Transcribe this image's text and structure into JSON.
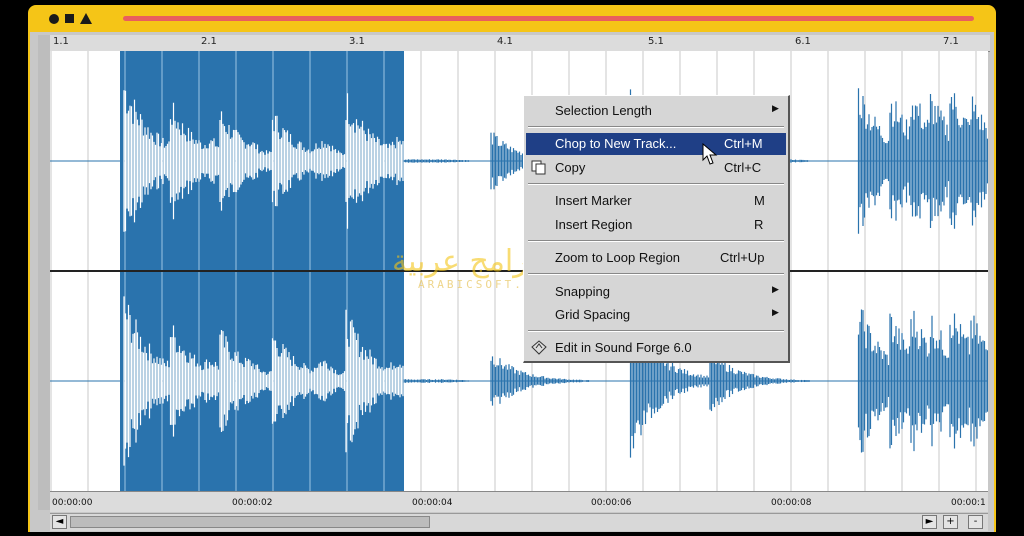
{
  "window_title": "",
  "colors": {
    "accent": "#f5c517",
    "stripe": "#e95e5e",
    "waveform": "#2a73ad",
    "highlight": "#1f3f86"
  },
  "ruler": {
    "labels": [
      "1.1",
      "2.1",
      "3.1",
      "4.1",
      "5.1",
      "6.1",
      "7.1"
    ]
  },
  "timeline": {
    "labels": [
      "00:00:00",
      "00:00:02",
      "00:00:04",
      "00:00:06",
      "00:00:08",
      "00:00:1"
    ]
  },
  "context_menu": {
    "items": [
      {
        "label": "Selection Length",
        "shortcut": "",
        "submenu": true
      },
      {
        "label": "Chop to New Track...",
        "shortcut": "Ctrl+M",
        "highlighted": true
      },
      {
        "label": "Copy",
        "shortcut": "Ctrl+C",
        "icon": "copy-icon"
      },
      {
        "label": "Insert Marker",
        "shortcut": "M"
      },
      {
        "label": "Insert Region",
        "shortcut": "R"
      },
      {
        "label": "Zoom to Loop Region",
        "shortcut": "Ctrl+Up"
      },
      {
        "label": "Snapping",
        "shortcut": "",
        "submenu": true
      },
      {
        "label": "Grid Spacing",
        "shortcut": "",
        "submenu": true
      },
      {
        "label": "Edit in Sound Forge 6.0",
        "shortcut": "",
        "icon": "sound-forge-icon"
      }
    ]
  },
  "scrollbar": {
    "left_arrow": "◄",
    "right_arrow": "►",
    "zoom_in": "+",
    "zoom_out": "-"
  },
  "watermark": {
    "text": "محمل برامج عربية",
    "sub": "ARABICSOFT.ORG"
  }
}
